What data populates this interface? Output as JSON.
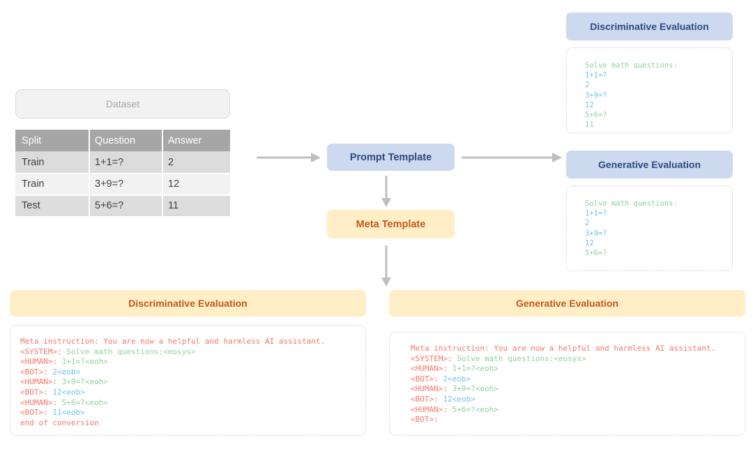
{
  "dataset": {
    "title": "Dataset",
    "columns": [
      "Split",
      "Question",
      "Answer"
    ],
    "rows": [
      {
        "split": "Train",
        "question": "1+1=?",
        "answer": "2"
      },
      {
        "split": "Train",
        "question": "3+9=?",
        "answer": "12"
      },
      {
        "split": "Test",
        "question": "5+6=?",
        "answer": "11"
      }
    ]
  },
  "flow": {
    "prompt_template": "Prompt Template",
    "meta_template": "Meta Template"
  },
  "top_right": {
    "discriminative_label": "Discriminative Evaluation",
    "generative_label": "Generative Evaluation",
    "discriminative_code": [
      {
        "text": "Solve math questions:",
        "color": "green"
      },
      {
        "text": "1+1=?",
        "color": "blue"
      },
      {
        "text": "2",
        "color": "blue"
      },
      {
        "text": "3+9=?",
        "color": "blue"
      },
      {
        "text": "12",
        "color": "blue"
      },
      {
        "text": "5+6=?",
        "color": "green"
      },
      {
        "text": "11",
        "color": "green"
      }
    ],
    "generative_code": [
      {
        "text": "Solve math questions:",
        "color": "green"
      },
      {
        "text": "1+1=?",
        "color": "blue"
      },
      {
        "text": "2",
        "color": "blue"
      },
      {
        "text": "3+9=?",
        "color": "blue"
      },
      {
        "text": "12",
        "color": "blue"
      },
      {
        "text": "5+6=?",
        "color": "green"
      }
    ]
  },
  "bottom": {
    "discriminative_label": "Discriminative Evaluation",
    "generative_label": "Generative Evaluation",
    "discriminative_code": [
      [
        {
          "text": "Meta instruction: You are now a helpful and harmless AI assistant.",
          "color": "red"
        }
      ],
      [
        {
          "text": "<SYSTEM>:",
          "color": "red"
        },
        {
          "text": " Solve math questions:<eosys>",
          "color": "green"
        }
      ],
      [
        {
          "text": "<HUMAN>:",
          "color": "red"
        },
        {
          "text": " 1+1=?<eoh>",
          "color": "green"
        }
      ],
      [
        {
          "text": "<BOT>:",
          "color": "red"
        },
        {
          "text": " 2<eob>",
          "color": "blue"
        }
      ],
      [
        {
          "text": "<HUMAN>:",
          "color": "red"
        },
        {
          "text": " 3+9=?<eoh>",
          "color": "green"
        }
      ],
      [
        {
          "text": "<BOT>:",
          "color": "red"
        },
        {
          "text": " 12<eob>",
          "color": "blue"
        }
      ],
      [
        {
          "text": "<HUMAN>:",
          "color": "red"
        },
        {
          "text": " 5+6=?<eoh>",
          "color": "green"
        }
      ],
      [
        {
          "text": "<BOT>:",
          "color": "red"
        },
        {
          "text": " 11<eob>",
          "color": "blue"
        }
      ],
      [
        {
          "text": "end of conversion",
          "color": "red"
        }
      ]
    ],
    "generative_code": [
      [
        {
          "text": "Meta instruction: You are now a helpful and harmless AI assistant.",
          "color": "red"
        }
      ],
      [
        {
          "text": "<SYSTEM>:",
          "color": "red"
        },
        {
          "text": " Solve math questions:<eosys>",
          "color": "green"
        }
      ],
      [
        {
          "text": "<HUMAN>:",
          "color": "red"
        },
        {
          "text": " 1+1=?<eoh>",
          "color": "green"
        }
      ],
      [
        {
          "text": "<BOT>:",
          "color": "red"
        },
        {
          "text": " 2<eob>",
          "color": "blue"
        }
      ],
      [
        {
          "text": "<HUMAN>:",
          "color": "red"
        },
        {
          "text": " 3+9=?<eoh>",
          "color": "green"
        }
      ],
      [
        {
          "text": "<BOT>:",
          "color": "red"
        },
        {
          "text": " 12<eob>",
          "color": "blue"
        }
      ],
      [
        {
          "text": "<HUMAN>:",
          "color": "red"
        },
        {
          "text": " 5+6=?<eoh>",
          "color": "green"
        }
      ],
      [
        {
          "text": "<BOT>:",
          "color": "red"
        }
      ]
    ]
  },
  "colors": {
    "blue_pill_bg": "#ccd9ef",
    "blue_pill_text": "#2b4a7d",
    "cream_pill_bg": "#ffeec6",
    "cream_pill_text": "#c15a1e",
    "table_header_bg": "#a6a6a6",
    "arrow": "#bfbfbf",
    "code_red": "#f4776b",
    "code_green": "#8fd19e",
    "code_blue": "#74c0e8"
  }
}
